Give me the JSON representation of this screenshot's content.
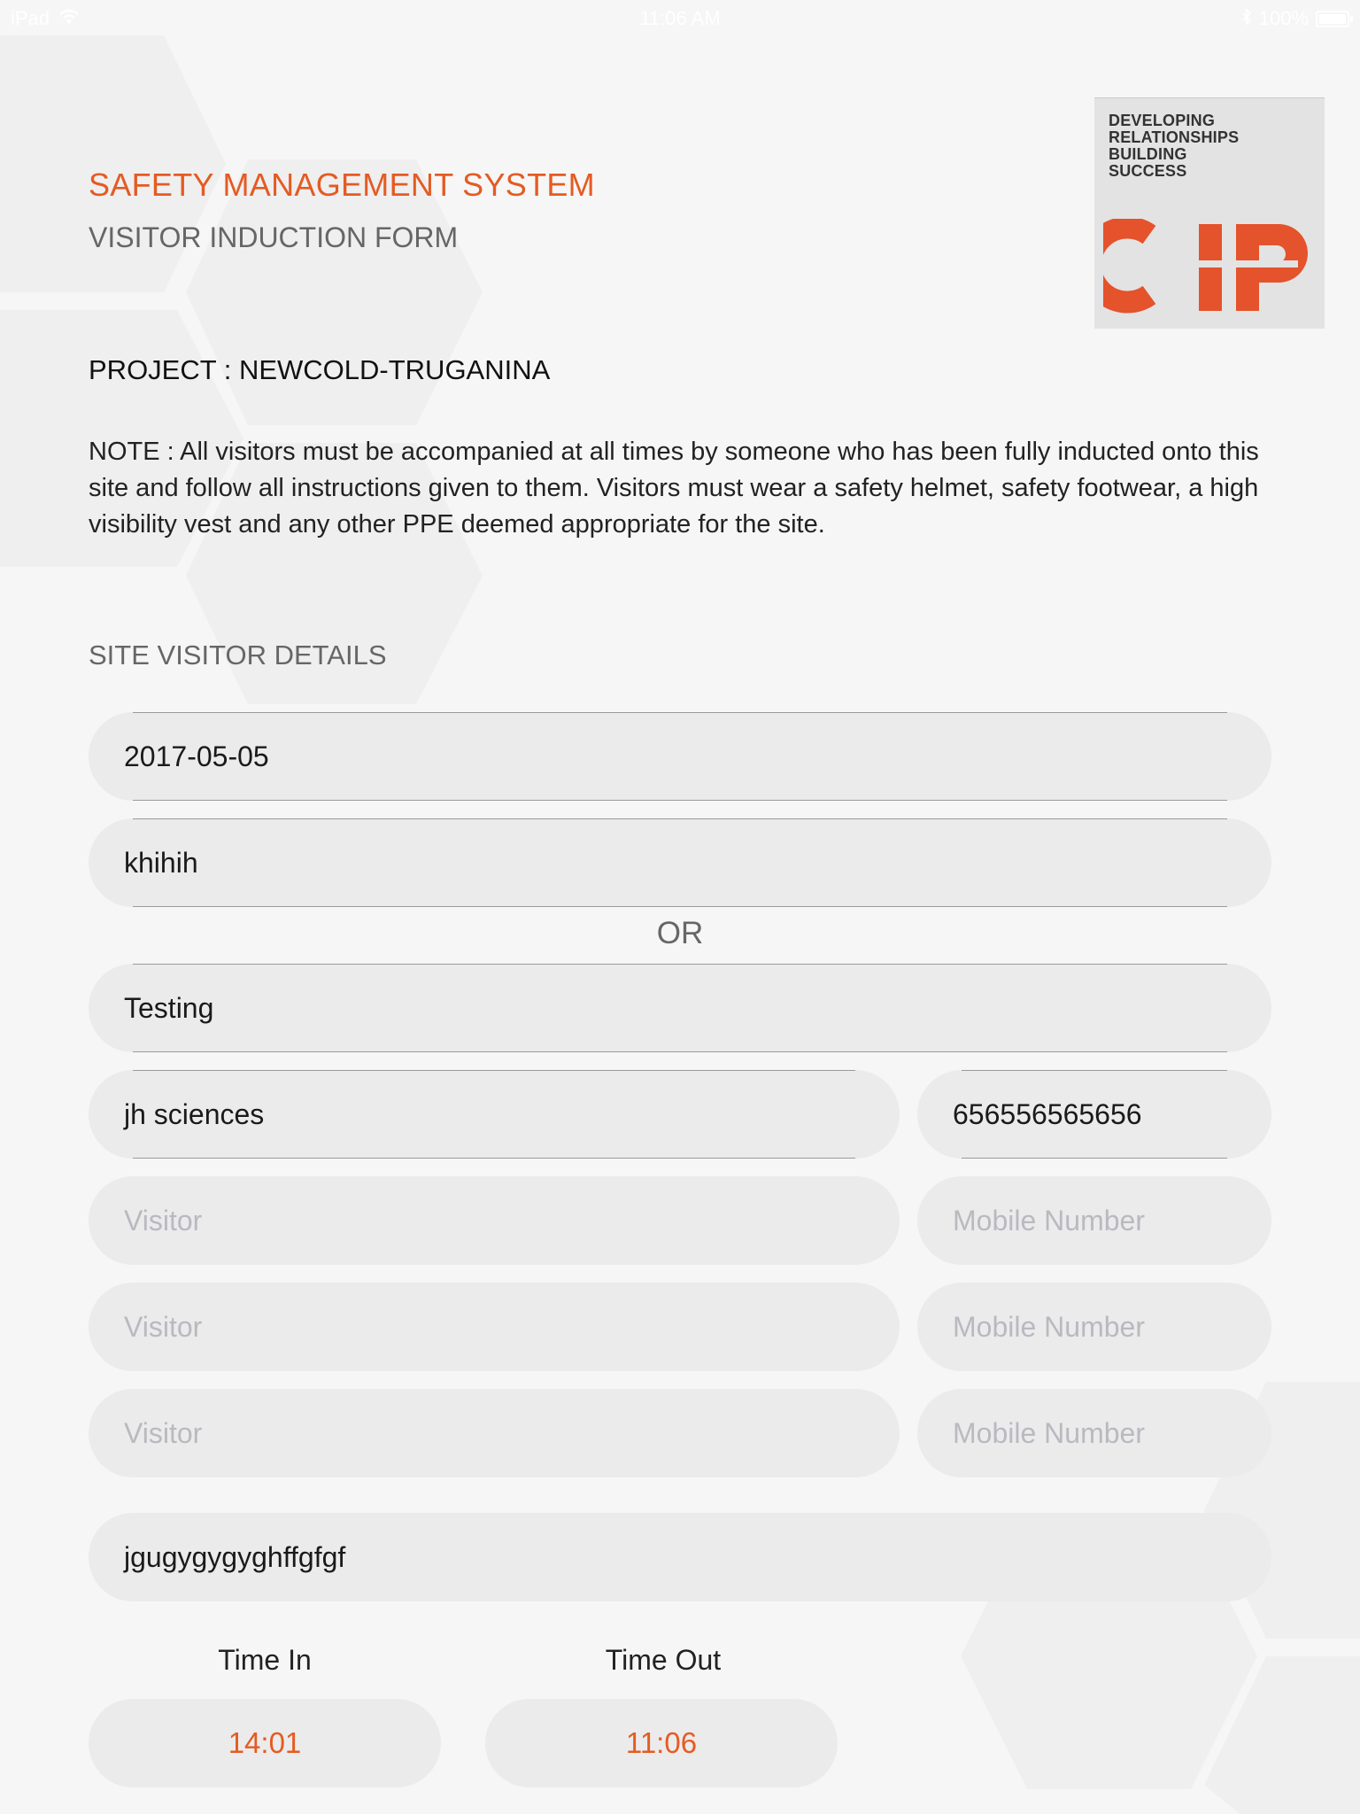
{
  "status_bar": {
    "device": "iPad",
    "time": "11:06 AM",
    "battery": "100%",
    "battery_level": 1.0
  },
  "header": {
    "title": "SAFETY MANAGEMENT SYSTEM",
    "subtitle": "VISITOR INDUCTION FORM"
  },
  "logo": {
    "tagline": "DEVELOPING\nRELATIONSHIPS\nBUILDING\nSUCCESS",
    "brand": "CIP",
    "brand_color": "#e4532b"
  },
  "project": "PROJECT : NEWCOLD-TRUGANINA",
  "note": "NOTE : All visitors must be accompanied at all times by someone who has been fully inducted onto this site and follow all instructions given to them. Visitors must wear a safety helmet, safety footwear, a high visibility vest and any other PPE deemed appropriate for the site.",
  "section_title": "SITE VISITOR DETAILS",
  "form": {
    "date": "2017-05-05",
    "field_2": "khihih",
    "or_label": "OR",
    "field_3": "Testing",
    "visitors": [
      {
        "name": "jh sciences",
        "name_placeholder": "Visitor",
        "mobile": "656556565656",
        "mobile_placeholder": "Mobile Number"
      },
      {
        "name": "",
        "name_placeholder": "Visitor",
        "mobile": "",
        "mobile_placeholder": "Mobile Number"
      },
      {
        "name": "",
        "name_placeholder": "Visitor",
        "mobile": "",
        "mobile_placeholder": "Mobile Number"
      },
      {
        "name": "",
        "name_placeholder": "Visitor",
        "mobile": "",
        "mobile_placeholder": "Mobile Number"
      }
    ],
    "purpose": "jgugygygyghffgfgf",
    "time_in_label": "Time In",
    "time_in": "14:01",
    "time_out_label": "Time Out",
    "time_out": "11:06"
  },
  "colors": {
    "accent": "#e45b23",
    "background": "#f6f6f6",
    "field": "#ebebeb"
  }
}
